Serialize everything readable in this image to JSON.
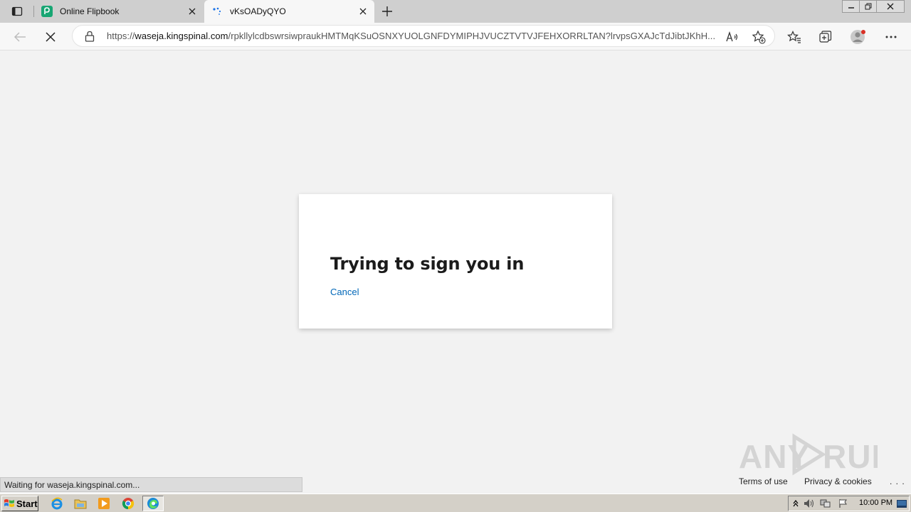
{
  "browser": {
    "tabs": [
      {
        "title": "Online Flipbook",
        "active": false
      },
      {
        "title": "vKsOADyQYO",
        "active": true
      }
    ],
    "url": {
      "scheme": "https://",
      "host": "waseja.kingspinal.com",
      "path": "/rpkllylcdbswrsiwpraukHMTMqKSuOSNXYUOLGNFDYMIPHJVUCZTVTVJFEHXORRLTAN?lrvpsGXAJcTdJibtJKhH..."
    },
    "status_text": "Waiting for waseja.kingspinal.com..."
  },
  "page": {
    "heading": "Trying to sign you in",
    "cancel_label": "Cancel",
    "footer": {
      "terms": "Terms of use",
      "privacy": "Privacy & cookies",
      "more": ". . ."
    }
  },
  "watermark": {
    "text_left": "ANY",
    "text_right": "RUN"
  },
  "taskbar": {
    "start_label": "Start",
    "clock": "10:00 PM"
  },
  "colors": {
    "link": "#0067b8",
    "page_bg": "#f2f2f2",
    "tabstrip_bg": "#cfcfcf"
  }
}
